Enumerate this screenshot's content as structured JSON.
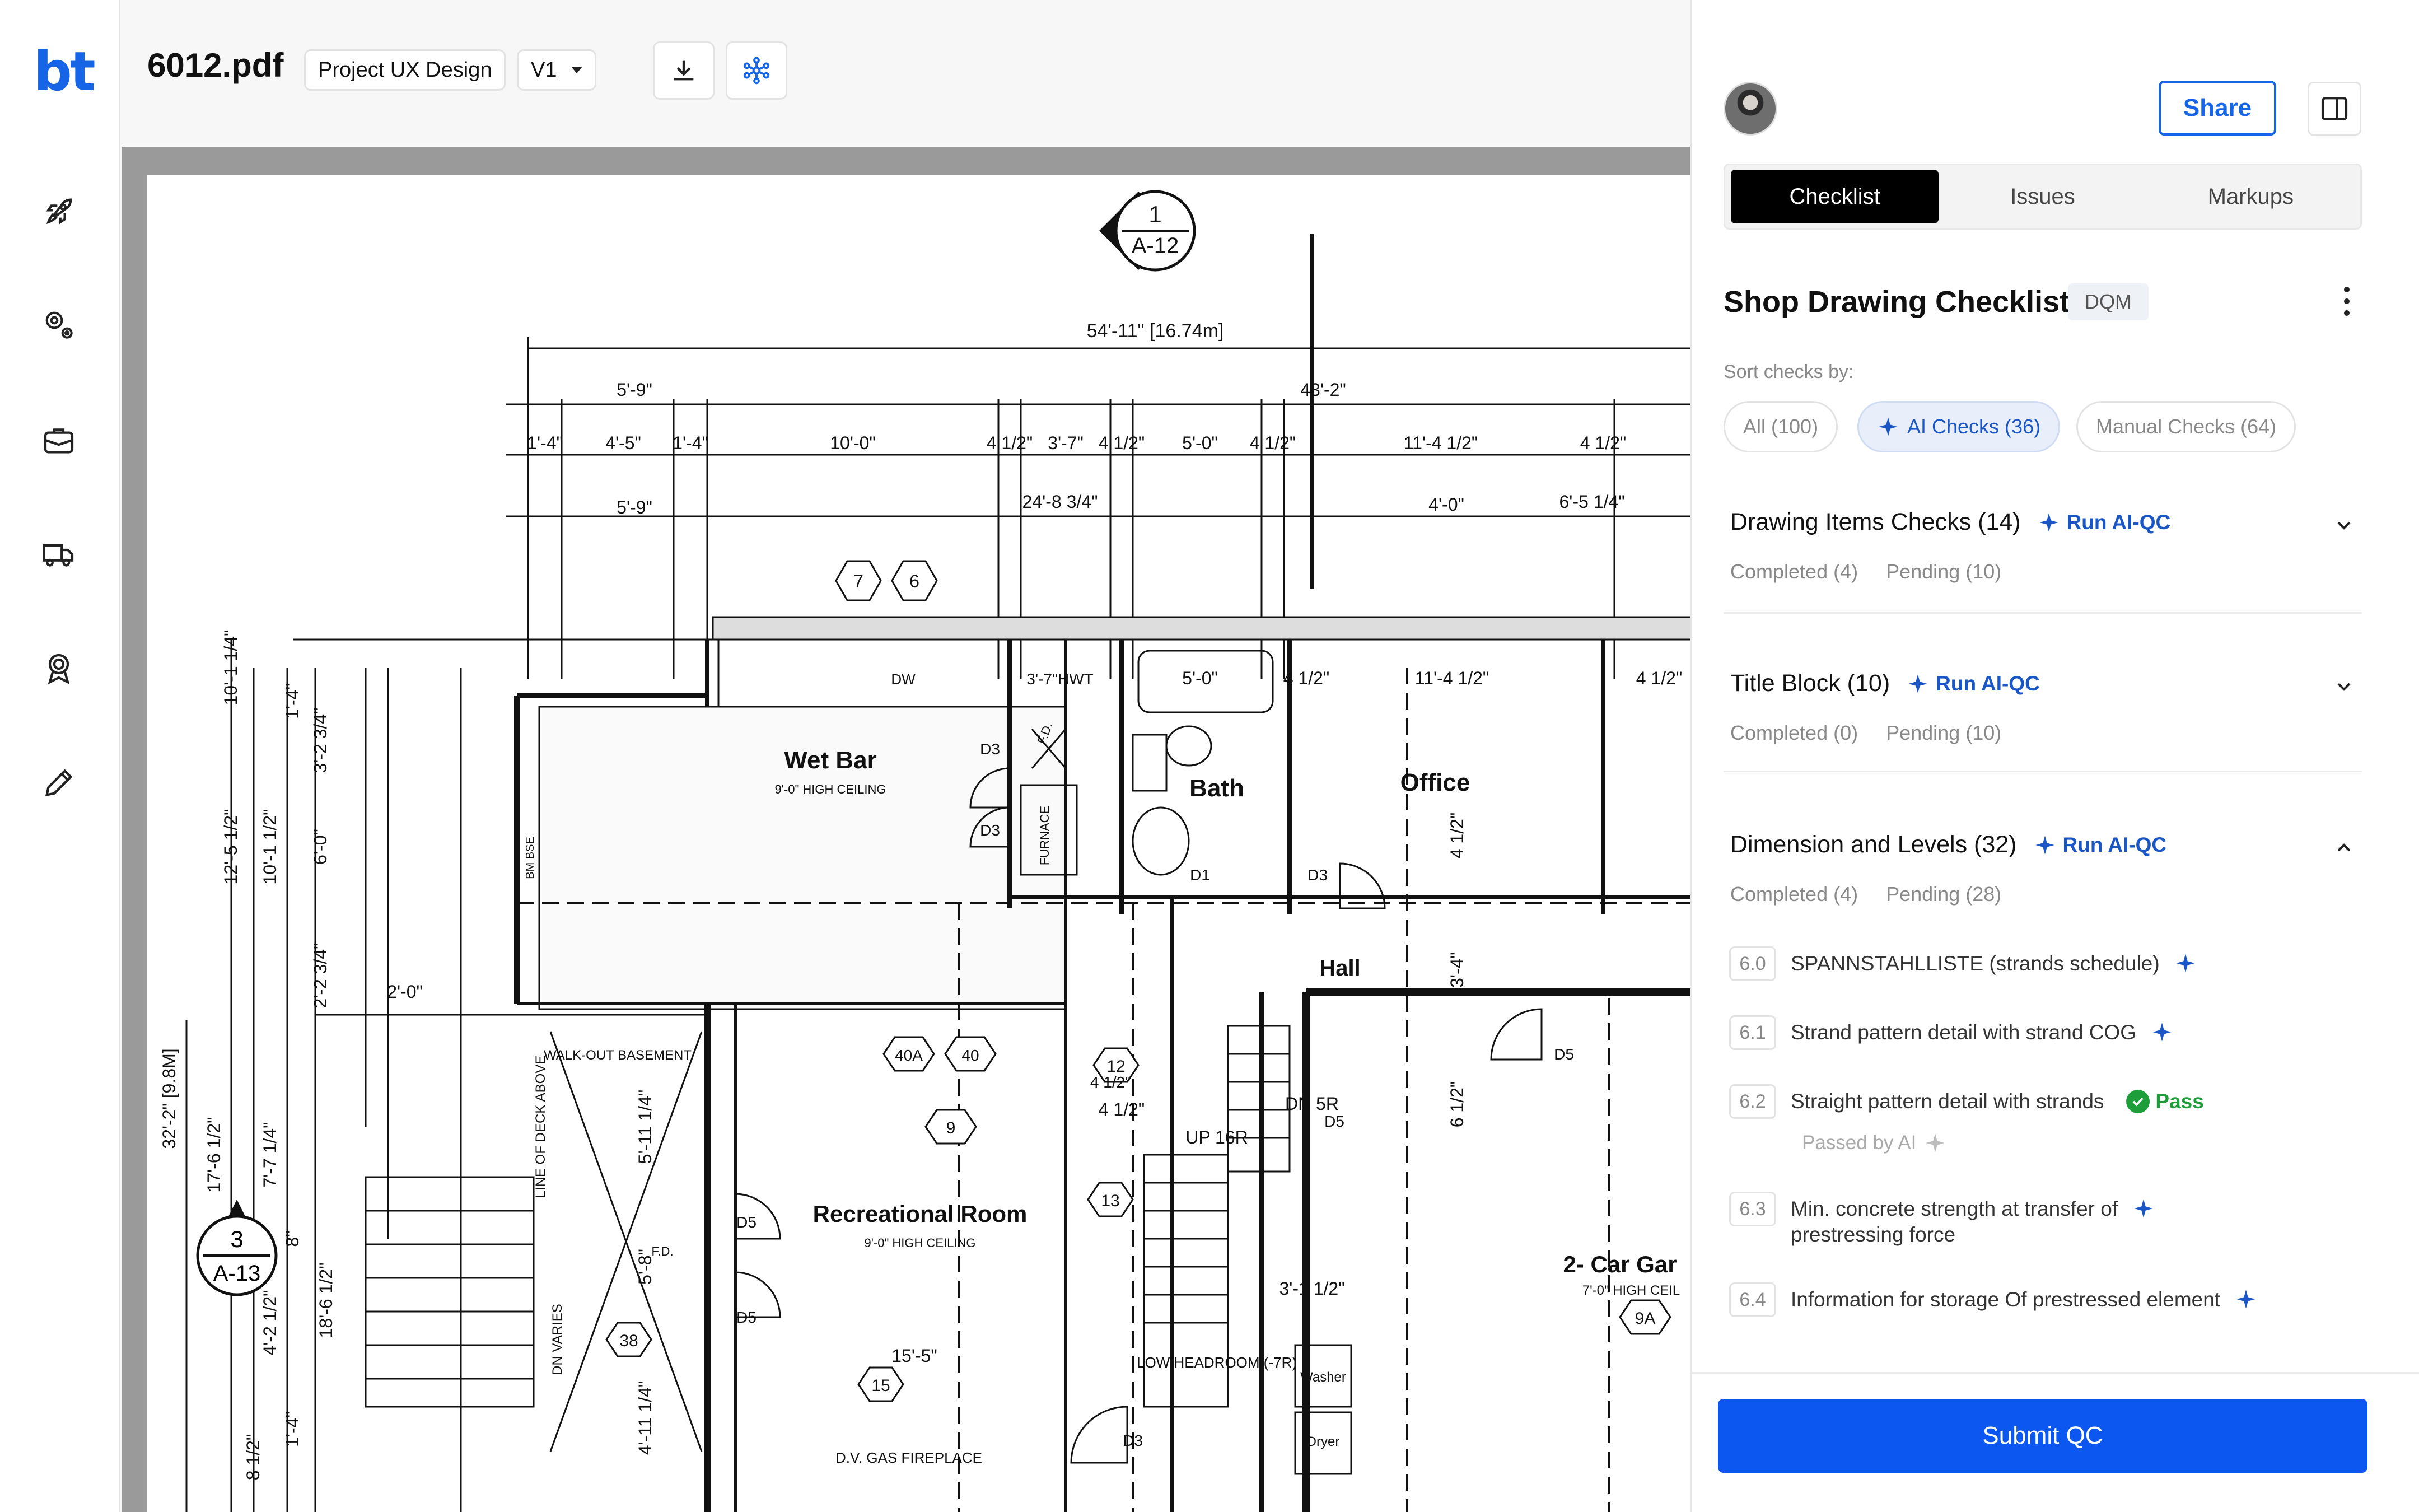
{
  "app": {
    "logo": "bt"
  },
  "rail": {
    "items": [
      {
        "name": "rocket-icon"
      },
      {
        "name": "settings-icon"
      },
      {
        "name": "briefcase-icon"
      },
      {
        "name": "truck-icon"
      },
      {
        "name": "award-icon"
      },
      {
        "name": "pencil-icon"
      }
    ]
  },
  "topbar": {
    "file_name": "6012.pdf",
    "project": "Project UX Design",
    "version": "V1",
    "download_icon": "download-icon",
    "network_icon": "network-icon"
  },
  "drawing": {
    "labels": {
      "title_tag_num": "1",
      "title_tag_sheet": "A-12",
      "section_tag_num": "3",
      "section_tag_sheet": "A-13",
      "overall_dim": "54'-11\" [16.74m]",
      "dim_5_9a": "5'-9\"",
      "dim_5_9b": "5'-9\"",
      "dim_43_2": "43'-2\"",
      "dim_1_4a": "1'-4\"",
      "dim_4_5": "4'-5\"",
      "dim_1_4b": "1'-4\"",
      "dim_10_0": "10'-0\"",
      "dim_4_5_12a": "4 1/2\"",
      "dim_3_7": "3'-7\"",
      "dim_4_5_12b": "4 1/2\"",
      "dim_5_0a": "5'-0\"",
      "dim_4_5_12c": "4 1/2\"",
      "dim_11_4_12a": "11'-4 1/2\"",
      "dim_4_5_12d": "4 1/2\"",
      "dim_24_8": "24'-8 3/4\"",
      "dim_4_0": "4'-0\"",
      "dim_6_5": "6'-5 1/4\"",
      "hex_7": "7",
      "hex_6": "6",
      "dw": "DW",
      "hwt": "3'-7\"HWT",
      "dim_5_0b": "5'-0\"",
      "dim_4_5_12e": "4 1/2\"",
      "dim_11_4_12b": "11'-4 1/2\"",
      "dim_4_5_12f": "4 1/2\"",
      "wet_bar": "Wet Bar",
      "ceiling_9a": "9'-0\" HIGH CEILING",
      "bath": "Bath",
      "office": "Office",
      "furnace": "FURNACE",
      "fd1": "F.D.",
      "d3a": "D3",
      "d3b": "D3",
      "d3c": "D3",
      "d3d": "D3",
      "d1": "D1",
      "d5a": "D5",
      "d5b": "D5",
      "d5c": "D5",
      "d5d": "D5",
      "hall": "Hall",
      "dim_4_12": "4 1/2\"",
      "dim_3_4": "3'-4\"",
      "dim_6_12": "6 1/2\"",
      "walkout": "WALK-OUT BASEMENT",
      "line_deck": "LINE OF DECK ABOVE",
      "hex_40a": "40A",
      "hex_40": "40",
      "hex_9": "9",
      "hex_12": "12",
      "dim_4_12b": "4 1/2\"",
      "rec_room": "Recreational Room",
      "ceiling_9b": "9'-0\" HIGH CEILING",
      "hex_13": "13",
      "up_16r": "UP 16R",
      "dn_5r": "DN 5R",
      "dim_3_1": "3'-1 1/2\"",
      "hex_38": "38",
      "fd2": "F.D.",
      "dim_15_5": "15'-5\"",
      "hex_15": "15",
      "gas_fp": "D.V. GAS FIREPLACE",
      "low_headroom": "LOW HEADROOM (-7R)",
      "washer": "Washer",
      "dryer": "Dryer",
      "car_garage": "2- Car Gar",
      "ceiling_7": "7'-0\" HIGH CEIL",
      "hex_9a": "9A",
      "dn_varies": "DN VARIES",
      "v_dim_12_5": "12'-5 1/2\"",
      "v_dim_10_1": "10'-1 1/2\"",
      "v_dim_6_0": "6'-0\"",
      "v_dim_32_2": "32'-2\" [9.8M]",
      "v_dim_17_6": "17'-6 1/2\"",
      "v_dim_7_7": "7'-7 1/4\"",
      "v_dim_10_1b": "10'-1 1/4\"",
      "v_dim_3_2": "3'-2 3/4\"",
      "v_dim_2_2": "2'-2 3/4\"",
      "v_dim_1_4": "1'-4\"",
      "dim_2_0": "2'-0\"",
      "v_dim_5_11": "5'-11 1/4\"",
      "v_dim_5_8": "5'-8\"",
      "v_dim_4_11": "4'-11 1/4\"",
      "v_dim_18_6": "18'-6 1/2\"",
      "v_dim_4_2": "4'-2 1/2\"",
      "v_dim_8": "8\"",
      "v_dim_8_12": "8 1/2\"",
      "v_dim_1_4c": "1'-4\"",
      "v_dim_4_12c": "4 1/2\"",
      "bm_bse": "BM BSE"
    }
  },
  "panel": {
    "share_label": "Share",
    "tabs": [
      "Checklist",
      "Issues",
      "Markups"
    ],
    "checklist_title": "Shop Drawing Checklist",
    "badge": "DQM",
    "sort_label": "Sort checks by:",
    "filters": {
      "all": "All (100)",
      "ai": "AI Checks (36)",
      "manual": "Manual Checks (64)"
    },
    "run_ai_label": "Run AI-QC",
    "sections": [
      {
        "title": "Drawing Items Checks (14)",
        "completed": "Completed (4)",
        "pending": "Pending (10)"
      },
      {
        "title": "Title Block (10)",
        "completed": "Completed (0)",
        "pending": "Pending (10)"
      },
      {
        "title": "Dimension and Levels (32)",
        "completed": "Completed (4)",
        "pending": "Pending (28)"
      }
    ],
    "items": [
      {
        "num": "6.0",
        "text": "SPANNSTAHLLISTE (strands schedule)"
      },
      {
        "num": "6.1",
        "text": "Strand pattern detail with strand COG"
      },
      {
        "num": "6.2",
        "text": "Straight pattern detail with strands",
        "status": "Pass",
        "note": "Passed by AI"
      },
      {
        "num": "6.3",
        "text": "Min. concrete strength at transfer of",
        "text2": "prestressing force"
      },
      {
        "num": "6.4",
        "text": "Information for storage Of prestressed element"
      }
    ],
    "submit_label": "Submit QC"
  },
  "colors": {
    "brand": "#1565e6",
    "primary_button": "#0b57f0",
    "pass": "#1e9e3a"
  }
}
